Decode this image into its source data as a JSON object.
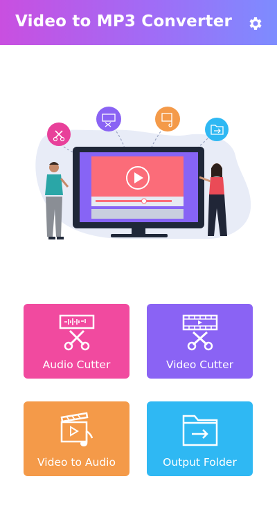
{
  "app": {
    "title": "Video to MP3 Converter",
    "accent_start": "#c94fe0",
    "accent_end": "#7d8cff"
  },
  "toolbar": {
    "settings_icon": "gear-icon"
  },
  "hero": {
    "illustration": "presentation-illustration",
    "screen_color": "#fb6c79",
    "frame_color": "#8764f5"
  },
  "tiles": [
    {
      "label": "Audio Cutter",
      "icon": "audio-cutter-icon",
      "color": "#f14a9f"
    },
    {
      "label": "Video Cutter",
      "icon": "video-cutter-icon",
      "color": "#8a63f4"
    },
    {
      "label": "Video to Audio",
      "icon": "video-to-audio-icon",
      "color": "#f49a49"
    },
    {
      "label": "Output Folder",
      "icon": "output-folder-icon",
      "color": "#2fb8f3"
    }
  ]
}
